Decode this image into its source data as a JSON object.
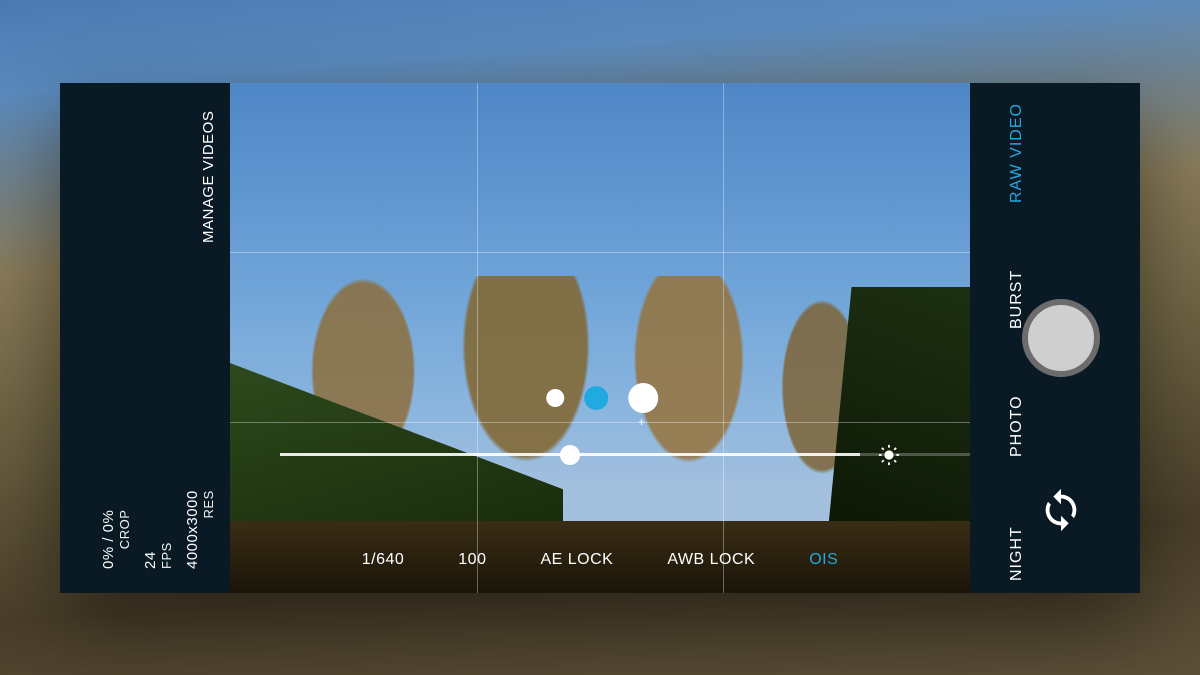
{
  "left": {
    "crop": {
      "value": "0% / 0%",
      "label": "CROP"
    },
    "fps": {
      "value": "24",
      "label": "FPS"
    },
    "res": {
      "value": "4000x3000",
      "label": "RES"
    },
    "manage": {
      "label": "MANAGE VIDEOS"
    }
  },
  "lenses": {
    "selected_index": 1
  },
  "toolbar": {
    "shutter": "1/640",
    "iso": "100",
    "ae_lock": "AE LOCK",
    "awb_lock": "AWB LOCK",
    "ois": "OIS",
    "ois_active": true
  },
  "exposure": {
    "slider_position": 0.5
  },
  "modes": {
    "items": [
      "NIGHT",
      "PHOTO",
      "BURST",
      "RAW VIDEO"
    ],
    "selected": "RAW VIDEO"
  },
  "colors": {
    "accent": "#21a9e1"
  }
}
